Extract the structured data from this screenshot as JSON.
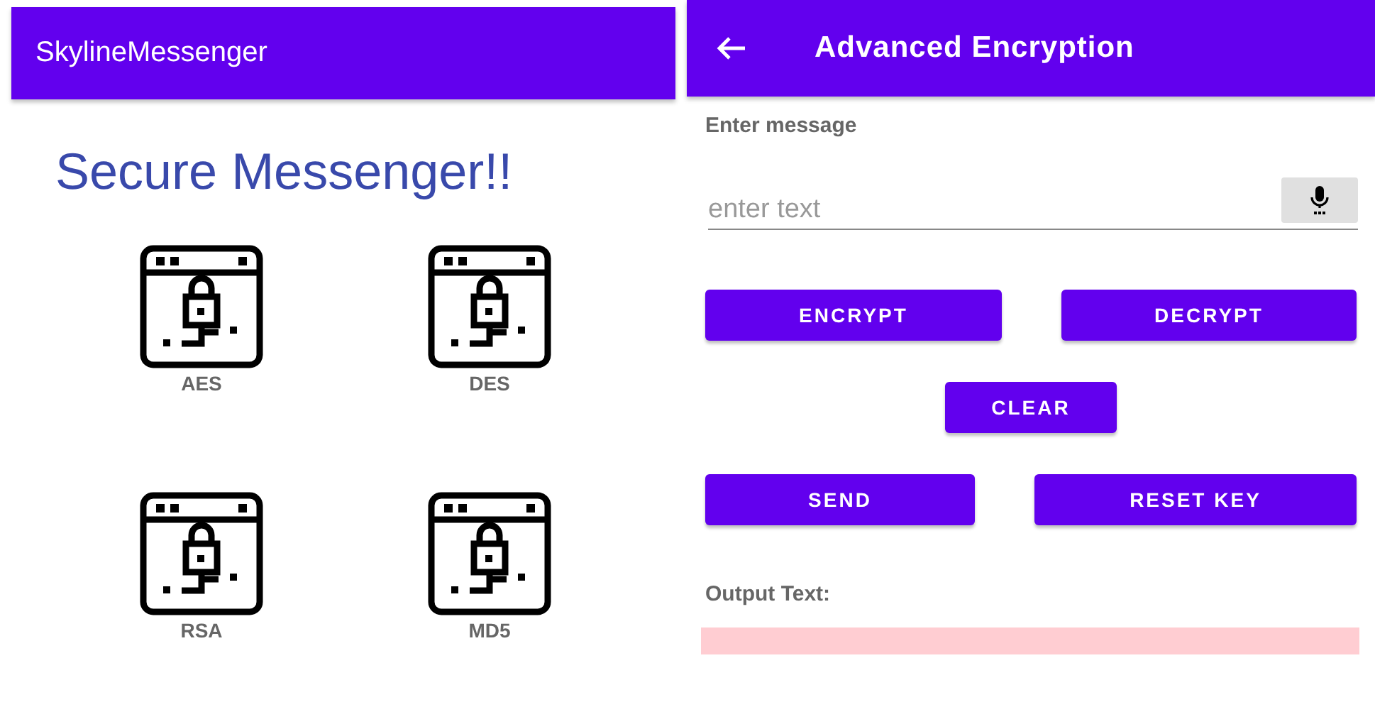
{
  "left_screen": {
    "app_title": "SkylineMessenger",
    "heading": "Secure Messenger!!",
    "algorithms": [
      {
        "label": "AES"
      },
      {
        "label": "DES"
      },
      {
        "label": "RSA"
      },
      {
        "label": "MD5"
      }
    ]
  },
  "right_screen": {
    "app_title": "Advanced Encryption",
    "message_label": "Enter message",
    "message_placeholder": "enter text",
    "buttons": [
      {
        "label": "ENCRYPT"
      },
      {
        "label": "DECRYPT"
      },
      {
        "label": "CLEAR"
      },
      {
        "label": "SEND"
      },
      {
        "label": "RESET KEY"
      }
    ],
    "output_label": "Output Text:"
  }
}
